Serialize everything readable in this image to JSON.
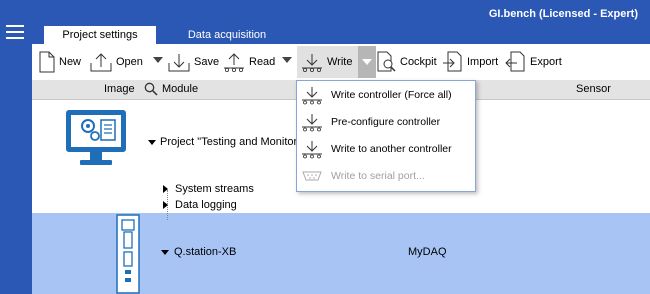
{
  "app": {
    "title": "GI.bench (Licensed - Expert)"
  },
  "tabs": [
    {
      "label": "Project settings",
      "active": true
    },
    {
      "label": "Data acquisition",
      "active": false
    }
  ],
  "toolbar": {
    "new_label": "New",
    "open_label": "Open",
    "save_label": "Save",
    "read_label": "Read",
    "write_label": "Write",
    "cockpit_label": "Cockpit",
    "import_label": "Import",
    "export_label": "Export"
  },
  "columns": {
    "image": "Image",
    "module": "Module",
    "sensor": "Sensor"
  },
  "tree": {
    "project_label": "Project \"Testing and Monitoring",
    "system_streams": "System streams",
    "data_logging": "Data logging",
    "controller_label": "Q.station-XB",
    "controller_module": "MyDAQ"
  },
  "write_menu": {
    "items": [
      {
        "label": "Write controller (Force all)",
        "enabled": true
      },
      {
        "label": "Pre-configure controller",
        "enabled": true
      },
      {
        "label": "Write to another controller",
        "enabled": true
      },
      {
        "label": "Write to serial port...",
        "enabled": false
      }
    ]
  },
  "colors": {
    "accent": "#2b57b5",
    "selection": "#a8c4f5",
    "header_bg": "#e3e3e3"
  }
}
